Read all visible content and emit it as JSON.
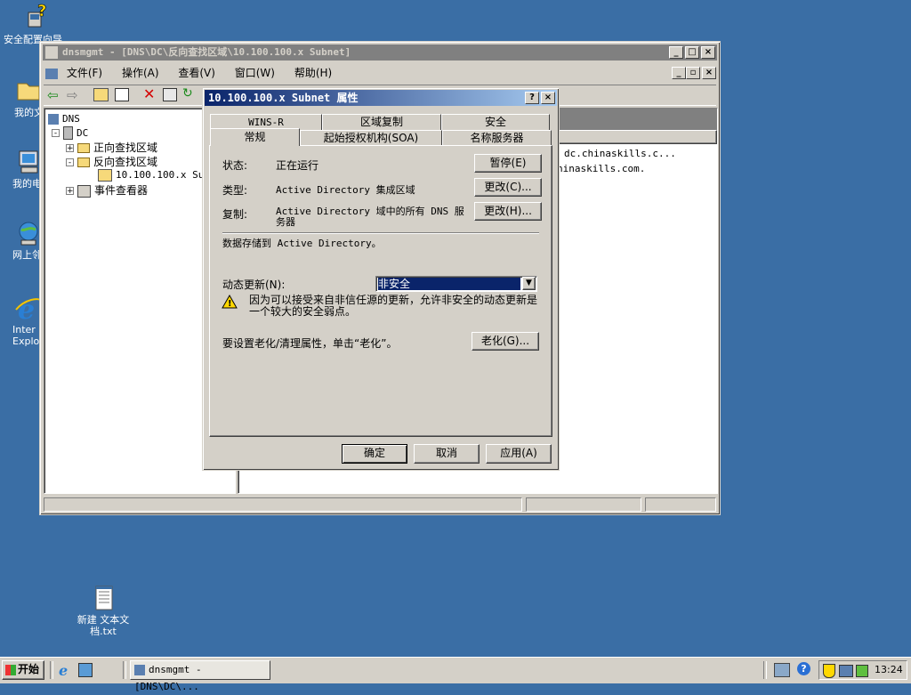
{
  "desktop": {
    "icons": [
      {
        "label": "安全配置向导"
      },
      {
        "label": "我的文"
      },
      {
        "label": "我的电"
      },
      {
        "label": "网上邻"
      },
      {
        "label": "Inter\nExplo"
      },
      {
        "label": "新建 文本文\n档.txt"
      }
    ]
  },
  "main_window": {
    "title": "dnsmgmt - [DNS\\DC\\反向查找区域\\10.100.100.x Subnet]",
    "menu": [
      "文件(F)",
      "操作(A)",
      "查看(V)",
      "窗口(W)",
      "帮助(H)"
    ],
    "tree": {
      "root": "DNS",
      "server": "DC",
      "forward": "正向查找区域",
      "reverse": "反向查找区域",
      "zone": "10.100.100.x Sub",
      "events": "事件查看器"
    },
    "right_rows": [
      "dc.chinaskills.c...",
      "hinaskills.com."
    ]
  },
  "dialog": {
    "title": "10.100.100.x Subnet 属性",
    "tabs_row1": [
      "WINS-R",
      "区域复制",
      "安全"
    ],
    "tabs_row2": [
      "常规",
      "起始授权机构(SOA)",
      "名称服务器"
    ],
    "status_label": "状态:",
    "status_value": "正在运行",
    "pause_button": "暂停(E)",
    "type_label": "类型:",
    "type_value": "Active Directory 集成区域",
    "change_type_button": "更改(C)...",
    "replication_label": "复制:",
    "replication_value": "Active Directory 域中的所有 DNS 服务器",
    "change_replication_button": "更改(H)...",
    "storage_text": "数据存储到 Active Directory。",
    "dynamic_update_label": "动态更新(N):",
    "dynamic_update_value": "非安全",
    "warning_text": "因为可以接受来自非信任源的更新，允许非安全的动态更新是一个较大的安全弱点。",
    "aging_text": "要设置老化/清理属性，单击“老化”。",
    "aging_button": "老化(G)...",
    "ok_button": "确定",
    "cancel_button": "取消",
    "apply_button": "应用(A)"
  },
  "taskbar": {
    "start_label": "开始",
    "task_label": "dnsmgmt - [DNS\\DC\\...",
    "clock": "13:24"
  },
  "colors": {
    "desktop": "#3a6ea5",
    "title_active_start": "#0a246a",
    "title_active_end": "#a6caf0",
    "selection": "#0a246a",
    "face": "#d4d0c8"
  }
}
